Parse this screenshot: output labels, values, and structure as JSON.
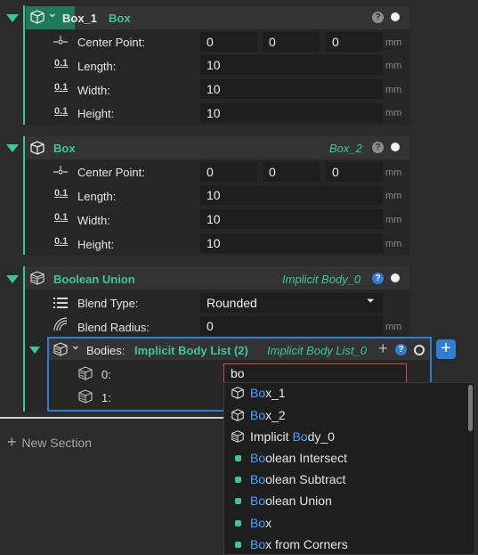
{
  "units": "mm",
  "box1": {
    "name": "Box_1",
    "type": "Box",
    "props": [
      {
        "label": "Center Point:",
        "values": [
          "0",
          "0",
          "0"
        ]
      },
      {
        "label": "Length:",
        "value": "10"
      },
      {
        "label": "Width:",
        "value": "10"
      },
      {
        "label": "Height:",
        "value": "10"
      }
    ]
  },
  "box2": {
    "name": "Box",
    "id": "Box_2",
    "props": [
      {
        "label": "Center Point:",
        "values": [
          "0",
          "0",
          "0"
        ]
      },
      {
        "label": "Length:",
        "value": "10"
      },
      {
        "label": "Width:",
        "value": "10"
      },
      {
        "label": "Height:",
        "value": "10"
      }
    ]
  },
  "union": {
    "name": "Boolean Union",
    "id": "Implicit Body_0",
    "blend_type_label": "Blend Type:",
    "blend_type_value": "Rounded",
    "blend_radius_label": "Blend Radius:",
    "blend_radius_value": "0",
    "bodies_label": "Bodies:",
    "bodies_type": "Implicit Body List (2)",
    "bodies_id": "Implicit Body List_0",
    "items": [
      {
        "label": "0:",
        "value": "bo"
      },
      {
        "label": "1:"
      }
    ]
  },
  "new_section": "New Section",
  "icon_glyphs": {
    "help": "?",
    "plus": "+",
    "chevron": "⌄",
    "dropdown": "⏷"
  },
  "dropdown": {
    "items": [
      {
        "match": "Bo",
        "rest": "x_1",
        "prefix": ""
      },
      {
        "match": "Bo",
        "rest": "x_2",
        "prefix": ""
      },
      {
        "prefix": "Implicit ",
        "match": "Bo",
        "rest": "dy_0"
      },
      {
        "prefix": "",
        "match": "Bo",
        "rest": "olean Intersect"
      },
      {
        "prefix": "",
        "match": "Bo",
        "rest": "olean Subtract"
      },
      {
        "prefix": "",
        "match": "Bo",
        "rest": "olean Union"
      },
      {
        "prefix": "",
        "match": "Bo",
        "rest": "x"
      },
      {
        "prefix": "",
        "match": "Bo",
        "rest": "x from Corners"
      }
    ]
  },
  "colors": {
    "accent": "#38c99a",
    "blue": "#2f7dd6",
    "error": "#d84a4a"
  }
}
